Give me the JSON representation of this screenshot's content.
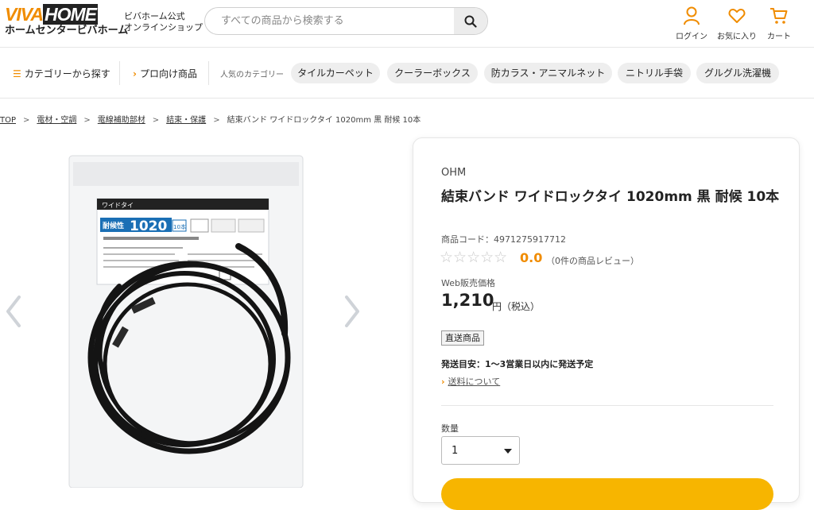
{
  "header": {
    "logo_top_a": "VIVA",
    "logo_top_b": "HOME",
    "logo_bottom": "ホームセンタービバホーム",
    "shop_line1": "ビバホーム公式",
    "shop_line2": "オンラインショップ",
    "search_placeholder": "すべての商品から検索する",
    "login_label": "ログイン",
    "favorites_label": "お気に入り",
    "cart_label": "カート"
  },
  "nav": {
    "category_link": "カテゴリーから探す",
    "pro_link": "プロ向け商品",
    "popular_label": "人気のカテゴリー",
    "chips": [
      "タイルカーペット",
      "クーラーボックス",
      "防カラス・アニマルネット",
      "ニトリル手袋",
      "グルグル洗濯機"
    ]
  },
  "breadcrumb": {
    "items": [
      "TOP",
      "電材・空調",
      "電線補助部材",
      "結束・保護"
    ],
    "current": "結束バンド ワイドロックタイ 1020mm 黒 耐候 10本"
  },
  "product": {
    "brand": "OHM",
    "title": "結束バンド ワイドロックタイ 1020mm 黒 耐候 10本",
    "code": "商品コード：4971275917712",
    "stars": "☆☆☆☆☆",
    "rating": "0.0",
    "reviews": "（0件の商品レビュー）",
    "price_label": "Web販売価格",
    "price": "1,210",
    "price_unit": "円（税込）",
    "badge": "直送商品",
    "shipping": "発送目安：1〜3営業日以内に発送予定",
    "shipping_link": "送料について",
    "qty_label": "数量",
    "qty_value": "1"
  },
  "package": {
    "brand": "ワイドタイ",
    "feature": "耐候性",
    "size": "1020",
    "count": "10本"
  },
  "colors": {
    "accent": "#f08c00",
    "cart_button": "#f7b500",
    "chip_bg": "#eeeeee",
    "package_blue": "#1a6fb5"
  }
}
